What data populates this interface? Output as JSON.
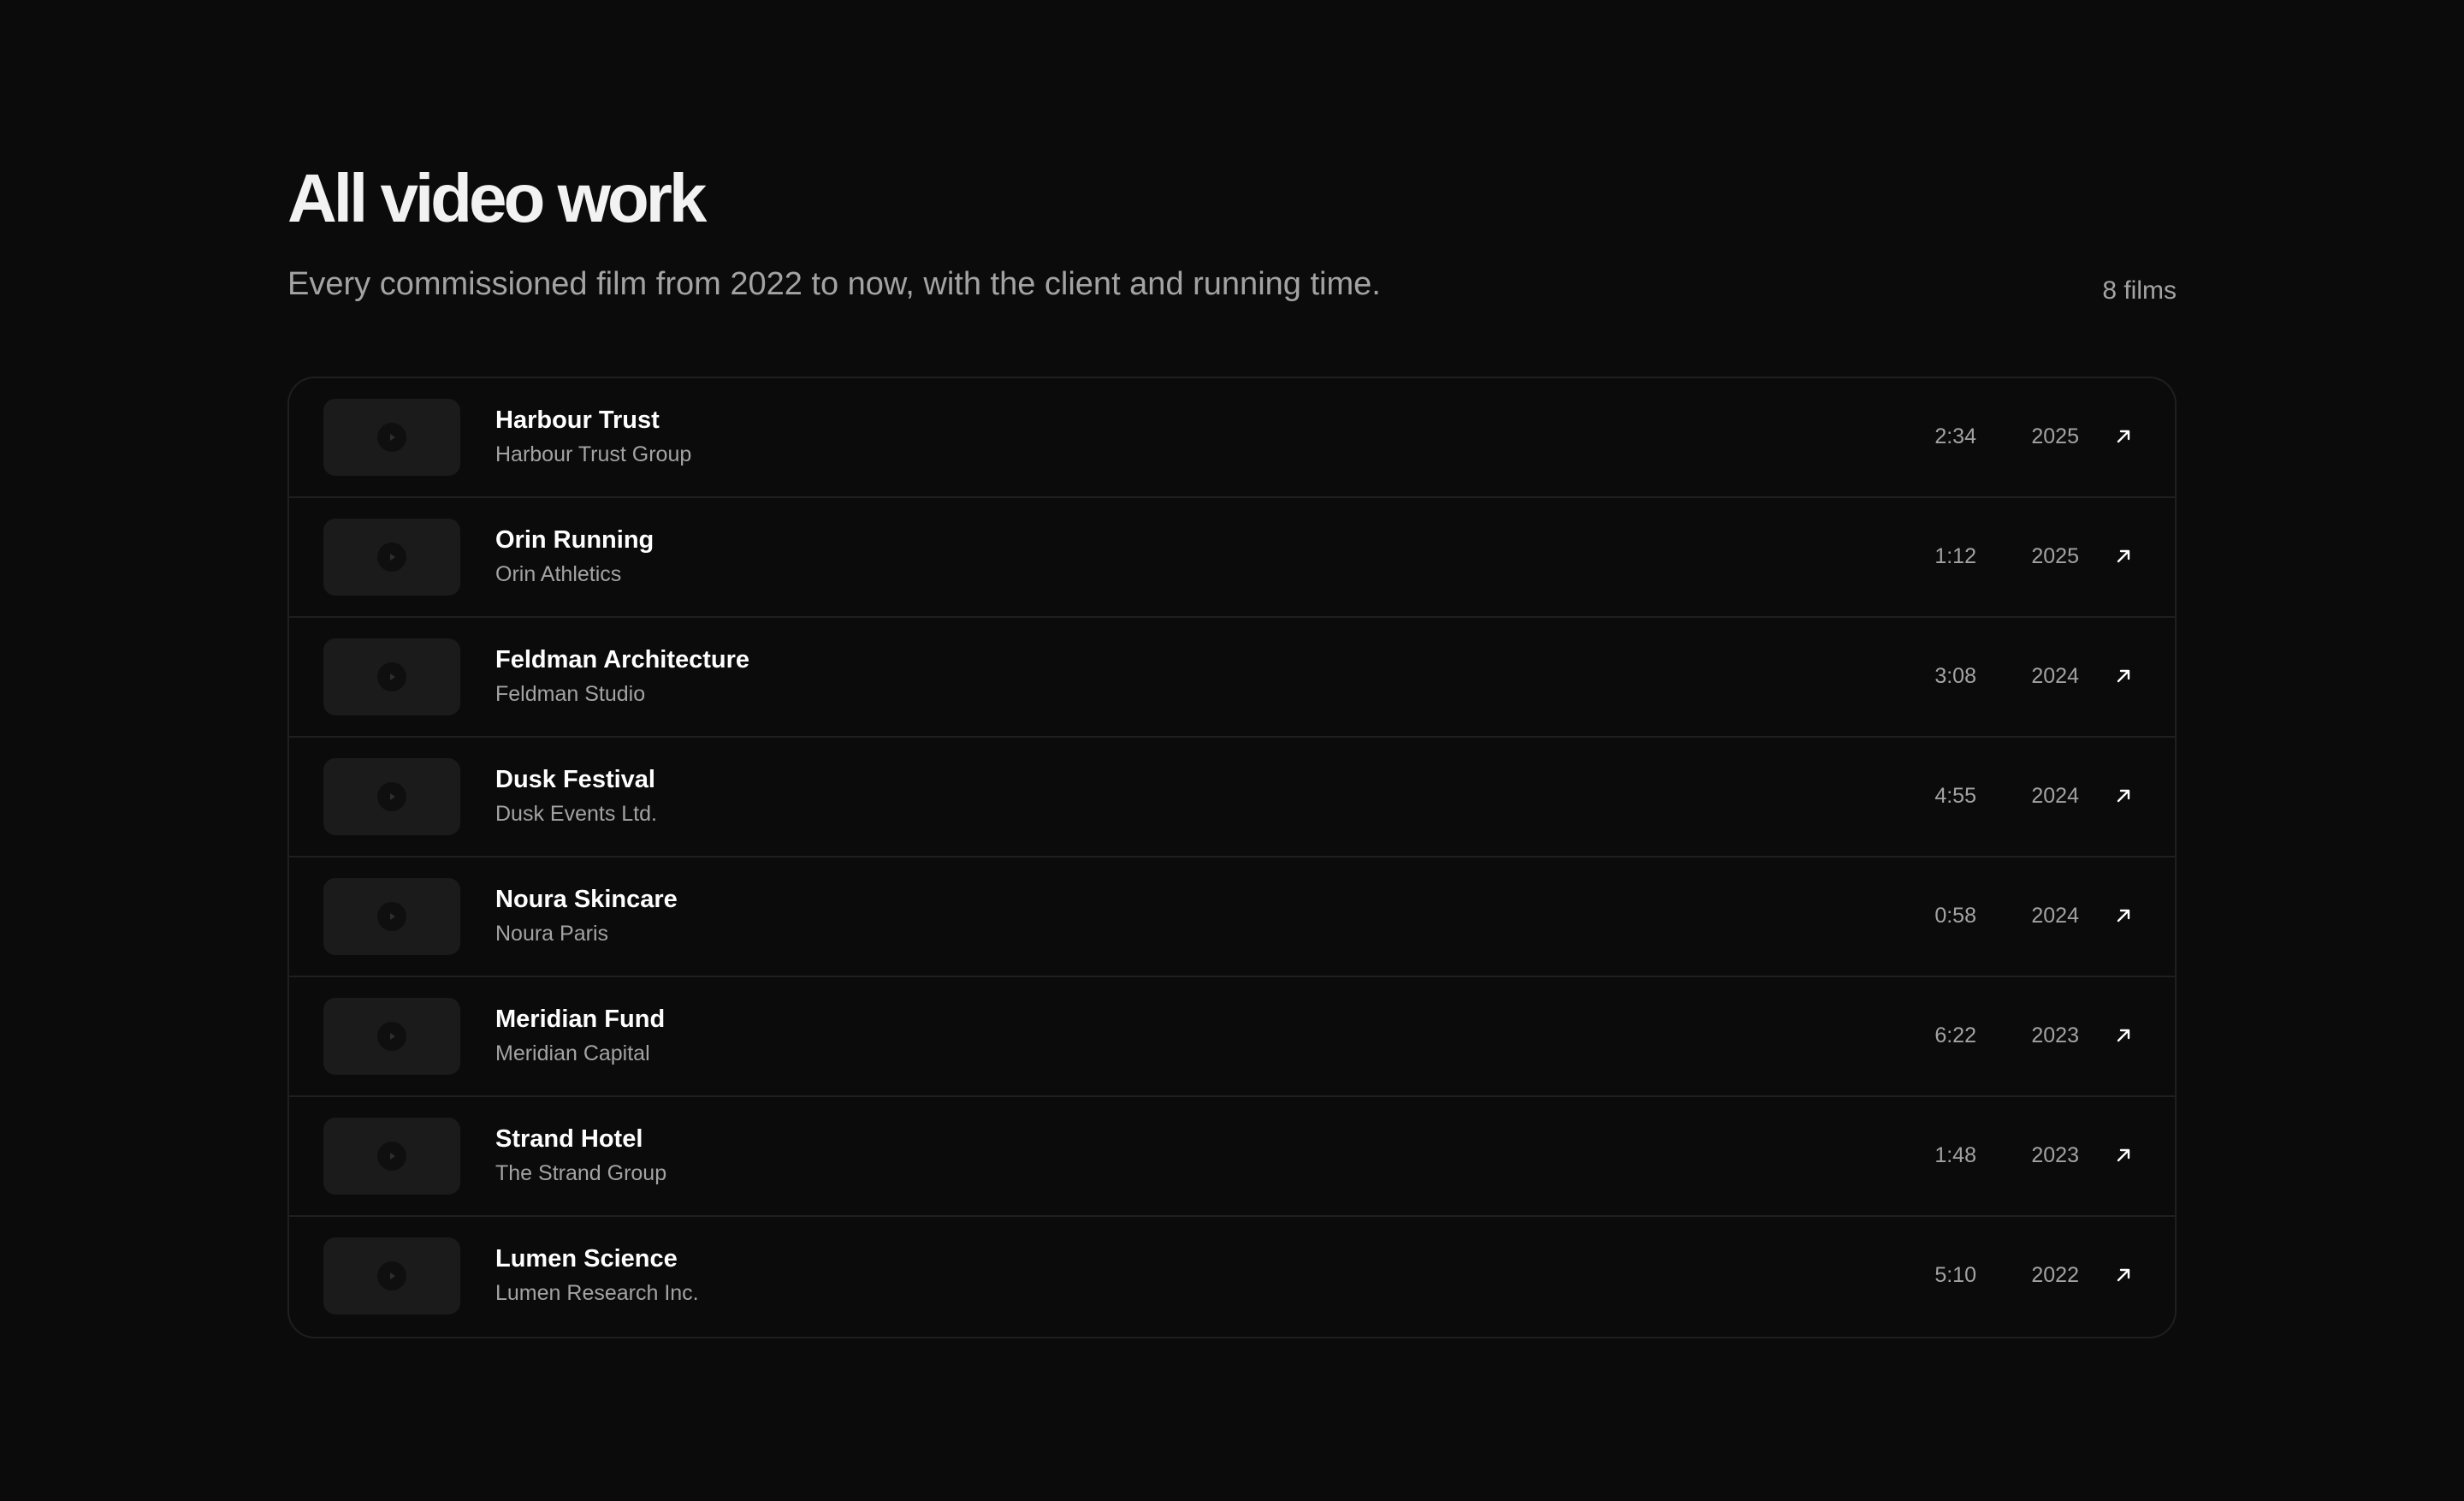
{
  "header": {
    "title": "All video work",
    "subtitle": "Every commissioned film from 2022 to now, with the client and running time.",
    "count": "8 films"
  },
  "icons": {
    "thumbnail": "play-icon",
    "open": "arrow-up-right-icon"
  },
  "colors": {
    "background": "#0b0b0b",
    "thumbnail": "#1b1b1b",
    "border": "#1f1f1f",
    "text_primary": "#ffffff",
    "text_secondary": "#a3a3a3"
  },
  "films": [
    {
      "title": "Harbour Trust",
      "client": "Harbour Trust Group",
      "duration": "2:34",
      "year": "2025"
    },
    {
      "title": "Orin Running",
      "client": "Orin Athletics",
      "duration": "1:12",
      "year": "2025"
    },
    {
      "title": "Feldman Architecture",
      "client": "Feldman Studio",
      "duration": "3:08",
      "year": "2024"
    },
    {
      "title": "Dusk Festival",
      "client": "Dusk Events Ltd.",
      "duration": "4:55",
      "year": "2024"
    },
    {
      "title": "Noura Skincare",
      "client": "Noura Paris",
      "duration": "0:58",
      "year": "2024"
    },
    {
      "title": "Meridian Fund",
      "client": "Meridian Capital",
      "duration": "6:22",
      "year": "2023"
    },
    {
      "title": "Strand Hotel",
      "client": "The Strand Group",
      "duration": "1:48",
      "year": "2023"
    },
    {
      "title": "Lumen Science",
      "client": "Lumen Research Inc.",
      "duration": "5:10",
      "year": "2022"
    }
  ]
}
